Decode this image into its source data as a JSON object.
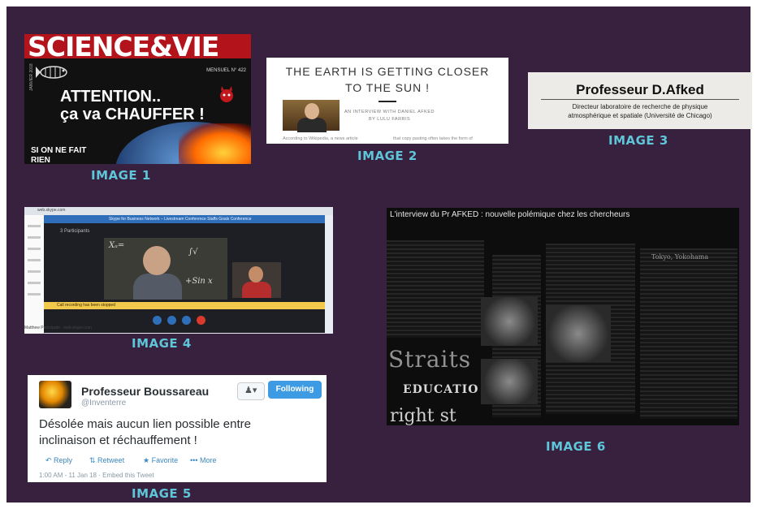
{
  "captions": {
    "image1": "IMAGE 1",
    "image2": "IMAGE 2",
    "image3": "IMAGE 3",
    "image4": "IMAGE 4",
    "image5": "IMAGE 5",
    "image6": "IMAGE 6"
  },
  "image1": {
    "masthead": "SCIENCE&VIE",
    "issue": "MENSUEL N° 422",
    "date": "JANVIER 2018",
    "headline_line1": "ATTENTION..",
    "headline_line2": "ça va CHAUFFER !",
    "bottom_line1": "SI ON NE FAIT",
    "bottom_line2": "RIEN"
  },
  "image2": {
    "title_line1": "THE EARTH IS GETTING CLOSER",
    "title_line2": "TO THE SUN !",
    "byline1": "AN INTERVIEW WITH DANIEL AFKED",
    "byline2": "BY LULU FARRIS",
    "snippet_left": "According to Wikipedia, a news article",
    "snippet_right": "that copy pasting often takes the form of"
  },
  "image3": {
    "name": "Professeur D.Afked",
    "desc_line1": "Directeur laboratoire de recherche de physique",
    "desc_line2": "atmosphérique et spatiale (Université de Chicago)"
  },
  "image4": {
    "browser_url": "web.skype.com",
    "window_title": "Skype for Business Network – Livestream Conference Staffs Goals Conference",
    "participants": "3 Participants",
    "notice": "Call recording has been stopped",
    "footer": "Matthew Participate · web.skype.com",
    "chalk": [
      "Xₐ=",
      "∫√",
      "+Sin x"
    ]
  },
  "image5": {
    "name": "Professeur Boussareau",
    "handle": "@Inventerre",
    "follow_label": "Following",
    "tweet_line1": "Désolée mais aucun lien possible entre",
    "tweet_line2": "inclinaison et réchauffement !",
    "reply": "Reply",
    "retweet": "Retweet",
    "favorite": "Favorite",
    "more": "More",
    "meta": "1:00 AM - 11 Jan 18 · Embed this Tweet"
  },
  "image6": {
    "title": "L'interview du Pr AFKED : nouvelle polémique chez les chercheurs",
    "paper_word1": "Straits",
    "paper_word2": "EDUCATIO",
    "paper_word3": "right st",
    "headline_fragment": "Tokyo, Yokohama"
  },
  "colors": {
    "slide_background": "#38203f",
    "caption": "#5ec6d8",
    "science_vie_red": "#b3141c",
    "twitter_blue": "#3d9be3"
  }
}
